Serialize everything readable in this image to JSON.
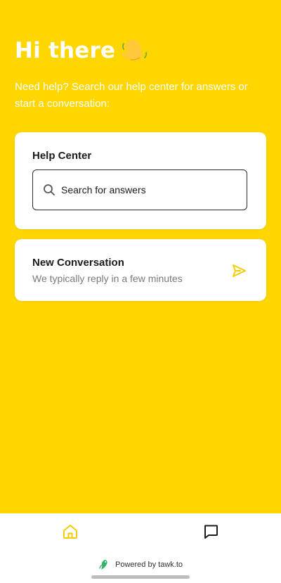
{
  "header": {
    "greeting": "Hi there",
    "greeting_icon": "waving-hand-icon",
    "subtitle": "Need help? Search our help center for answers or start a conversation:"
  },
  "help_center": {
    "title": "Help Center",
    "search_placeholder": "Search for answers",
    "search_icon": "search-icon"
  },
  "new_conversation": {
    "title": "New Conversation",
    "subtitle": "We typically reply in a few minutes",
    "icon": "send-icon"
  },
  "bottom_nav": {
    "items": [
      {
        "icon": "home-icon",
        "active": true
      },
      {
        "icon": "chat-icon",
        "active": false
      }
    ]
  },
  "footer": {
    "text": "Powered by tawk.to",
    "logo_icon": "tawk-logo-icon"
  },
  "colors": {
    "background": "#FFD600",
    "accent": "#F5CC00",
    "card": "#FFFFFF",
    "text_dark": "#1B1B1B",
    "text_muted": "#7A7A7A"
  }
}
